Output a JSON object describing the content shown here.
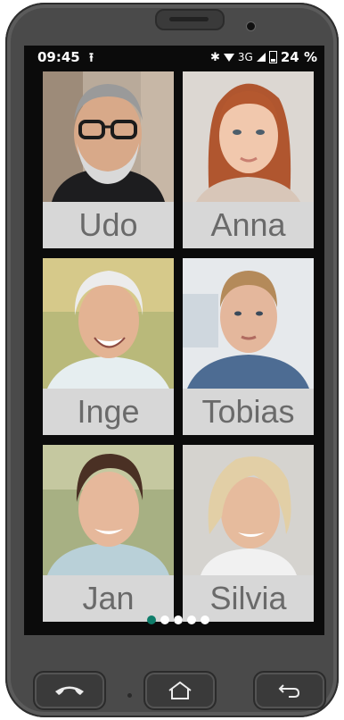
{
  "status_bar": {
    "time": "09:45",
    "upload_icon": "upload-icon",
    "bluetooth": "✱",
    "network": "3G",
    "battery": "24 %"
  },
  "contacts": [
    {
      "name": "Udo"
    },
    {
      "name": "Anna"
    },
    {
      "name": "Inge"
    },
    {
      "name": "Tobias"
    },
    {
      "name": "Jan"
    },
    {
      "name": "Silvia"
    }
  ],
  "pagination": {
    "pages": 5,
    "current": 1
  },
  "colors": {
    "tile_label_bg": "#d7d7d7",
    "tile_label_text": "#6a6a6a",
    "active_dot": "#0f7d6a"
  }
}
